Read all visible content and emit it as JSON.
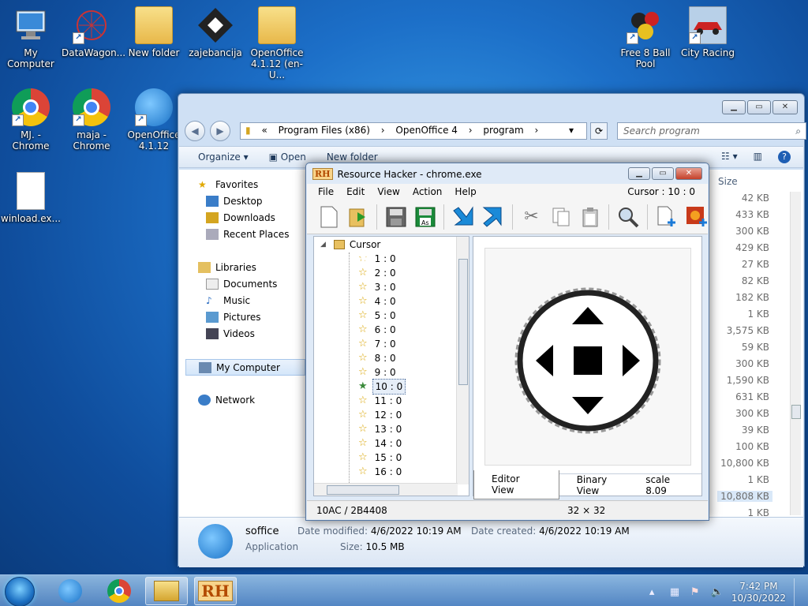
{
  "desktop": {
    "icons": [
      {
        "label": "My Computer",
        "icon": "computer-icon"
      },
      {
        "label": "DataWagon...",
        "icon": "datawagon-icon"
      },
      {
        "label": "New folder",
        "icon": "folder-icon"
      },
      {
        "label": "zajebancija",
        "icon": "app-icon"
      },
      {
        "label": "OpenOffice 4.1.12 (en-U...",
        "icon": "folder-icon"
      },
      {
        "label": "Free 8 Ball Pool",
        "icon": "billiards-icon"
      },
      {
        "label": "City Racing",
        "icon": "car-icon"
      },
      {
        "label": "MJ. - Chrome",
        "icon": "chrome-icon"
      },
      {
        "label": "maja - Chrome",
        "icon": "chrome-icon"
      },
      {
        "label": "OpenOffice 4.1.12",
        "icon": "openoffice-icon"
      },
      {
        "label": "winload.ex...",
        "icon": "file-icon"
      }
    ]
  },
  "explorer": {
    "breadcrumb": [
      "«",
      "Program Files (x86)",
      "›",
      "OpenOffice 4",
      "›",
      "program",
      "›"
    ],
    "search_placeholder": "Search program",
    "toolbar": {
      "organize": "Organize ▾",
      "open": "Open",
      "new_folder": "New folder"
    },
    "nav": {
      "favorites": "Favorites",
      "desktop": "Desktop",
      "downloads": "Downloads",
      "recent": "Recent Places",
      "libraries": "Libraries",
      "documents": "Documents",
      "music": "Music",
      "pictures": "Pictures",
      "videos": "Videos",
      "my_computer": "My Computer",
      "network": "Network"
    },
    "size_header": "Size",
    "sizes": [
      "42 KB",
      "433 KB",
      "300 KB",
      "429 KB",
      "27 KB",
      "82 KB",
      "182 KB",
      "1 KB",
      "3,575 KB",
      "59 KB",
      "300 KB",
      "1,590 KB",
      "631 KB",
      "300 KB",
      "39 KB",
      "100 KB",
      "10,800 KB",
      "1 KB",
      "10,808 KB",
      "1 KB"
    ],
    "details": {
      "name": "soffice",
      "type": "Application",
      "modified_label": "Date modified:",
      "modified_value": "4/6/2022 10:19 AM",
      "created_label": "Date created:",
      "created_value": "4/6/2022 10:19 AM",
      "size_label": "Size:",
      "size_value": "10.5 MB"
    }
  },
  "resource_hacker": {
    "logo": "RH",
    "title": "Resource Hacker - chrome.exe",
    "menu": [
      "File",
      "Edit",
      "View",
      "Action",
      "Help"
    ],
    "cursor_label": "Cursor : 10 : 0",
    "tree_root": "Cursor",
    "tree_items": [
      "1 : 0",
      "2 : 0",
      "3 : 0",
      "4 : 0",
      "5 : 0",
      "6 : 0",
      "7 : 0",
      "8 : 0",
      "9 : 0",
      "10 : 0",
      "11 : 0",
      "12 : 0",
      "13 : 0",
      "14 : 0",
      "15 : 0",
      "16 : 0"
    ],
    "selected_item": "10 : 0",
    "tabs": {
      "editor": "Editor View",
      "binary": "Binary View"
    },
    "scale": "scale 8.09",
    "status_left": "10AC / 2B4408",
    "status_right": "32 × 32"
  },
  "taskbar": {
    "time": "7:42 PM",
    "date": "10/30/2022"
  }
}
